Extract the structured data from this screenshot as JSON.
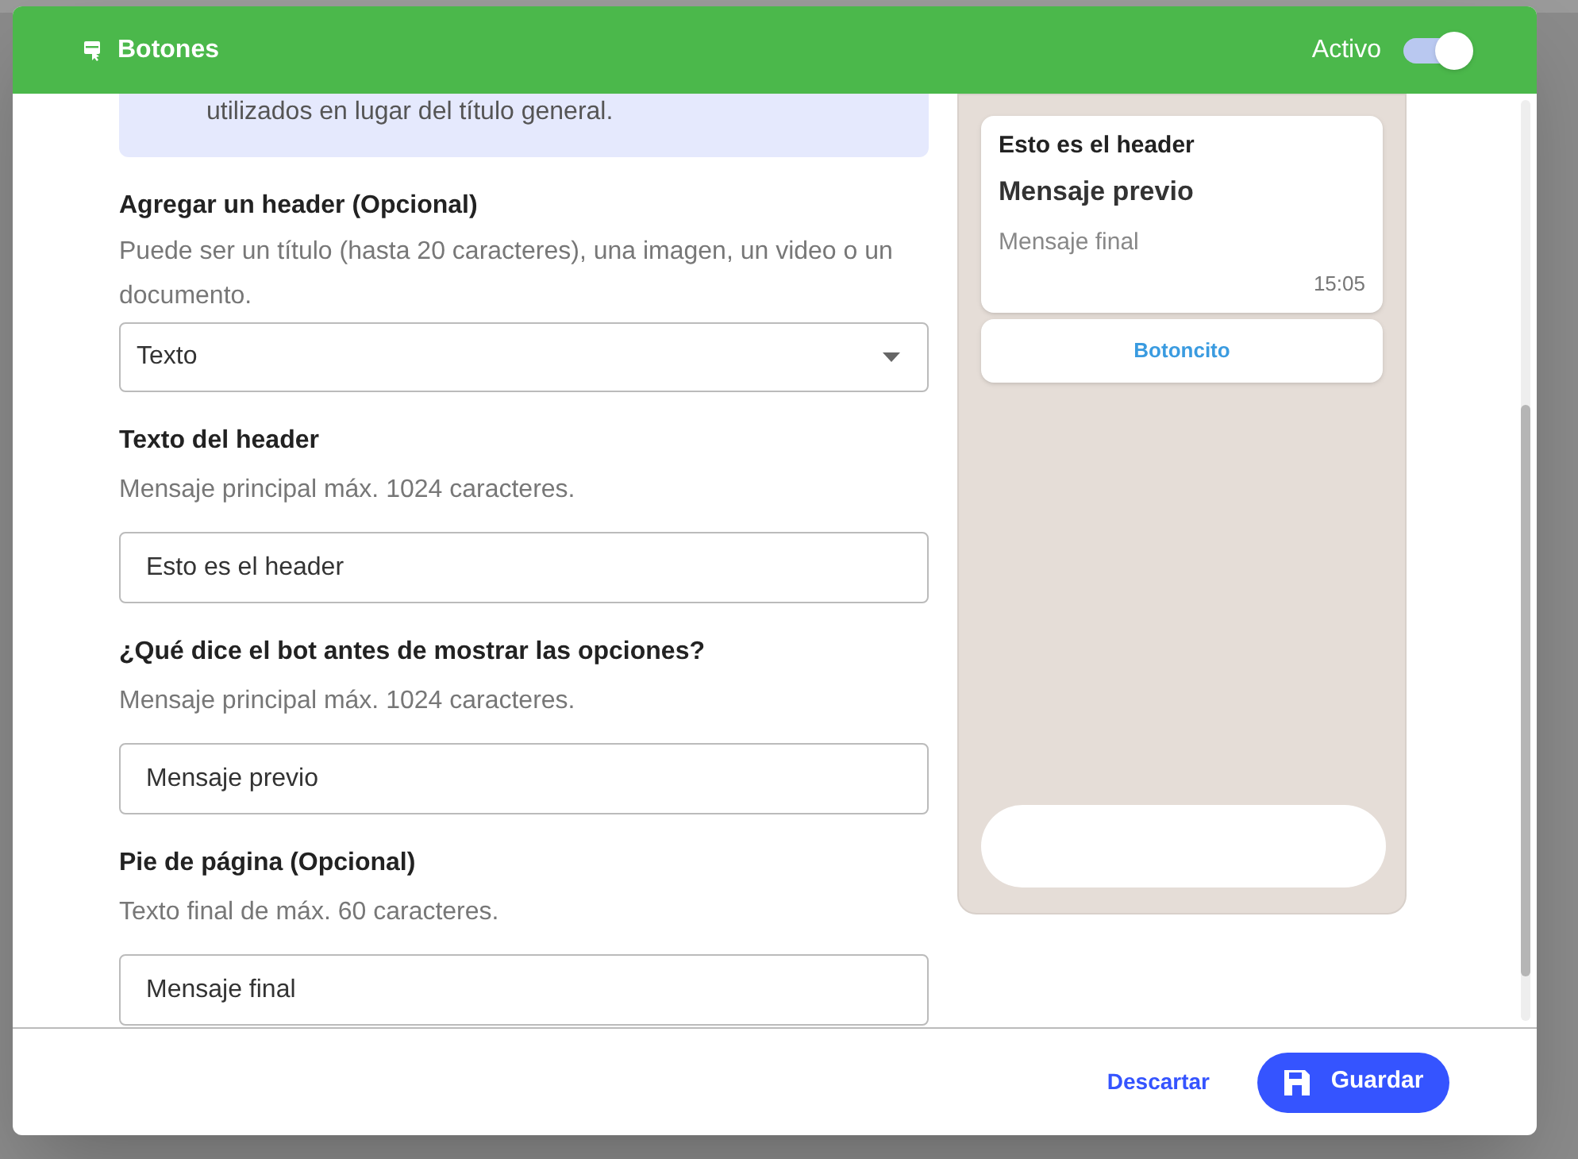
{
  "dialog": {
    "title": "Botones",
    "active_label": "Activo",
    "active": true
  },
  "info_note": "utilizados en lugar del título general.",
  "fields": [
    {
      "kind": "select",
      "label": "Agregar un header (Opcional)",
      "help": "Puede ser un título (hasta 20 caracteres), una imagen, un video o un documento.",
      "value": "Texto"
    },
    {
      "kind": "text",
      "label": "Texto del header",
      "help": "Mensaje principal máx. 1024 caracteres.",
      "value": "Esto es el header"
    },
    {
      "kind": "text",
      "label": "¿Qué dice el bot antes de mostrar las opciones?",
      "help": "Mensaje principal máx. 1024 caracteres.",
      "value": "Mensaje previo"
    },
    {
      "kind": "text",
      "label": "Pie de página (Opcional)",
      "help": "Texto final de máx. 60 caracteres.",
      "value": "Mensaje final"
    }
  ],
  "preview": {
    "header": "Esto es el header",
    "body": "Mensaje previo",
    "footer": "Mensaje final",
    "time": "15:05",
    "buttons": [
      "Botoncito"
    ]
  },
  "footer_buttons": {
    "discard": "Descartar",
    "save": "Guardar"
  }
}
